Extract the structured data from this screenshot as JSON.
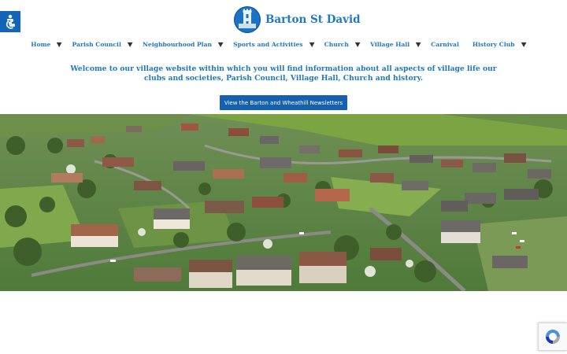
{
  "site": {
    "title": "Barton St David"
  },
  "nav": {
    "items": [
      {
        "label": "Home",
        "caret": true
      },
      {
        "label": "Parish Council",
        "caret": true
      },
      {
        "label": "Neighbourhood Plan",
        "caret": true
      },
      {
        "label": "Sports and Activities",
        "caret": true
      },
      {
        "label": "Church",
        "caret": true
      },
      {
        "label": "Village Hall",
        "caret": true
      },
      {
        "label": "Carnival",
        "caret": false
      },
      {
        "label": "History Club",
        "caret": true
      }
    ]
  },
  "intro": {
    "text": "Welcome to our village website within which you will find information about all aspects of village life our clubs and societies, Parish Council, Village Hall, Church and history."
  },
  "cta": {
    "label": "View the Barton and Wheathill Newsletters"
  },
  "icons": {
    "accessibility": "accessibility-icon",
    "logo": "church-logo-icon",
    "recaptcha": "recaptcha-icon",
    "caret": "caret-down-icon"
  },
  "colors": {
    "brand_blue": "#1e78c2",
    "button_blue": "#1660b0",
    "access_blue": "#1565b6"
  },
  "hero": {
    "description_kind": "aerial-village-photo"
  }
}
